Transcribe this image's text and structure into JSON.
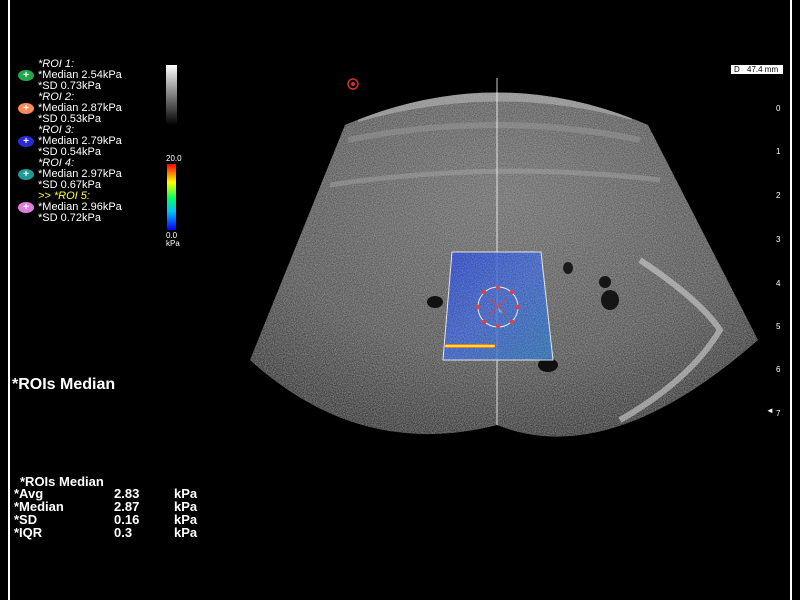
{
  "rois": [
    {
      "title": "*ROI 1:",
      "median": "*Median 2.54kPa",
      "sd": "*SD     0.73kPa",
      "icon": "plus-icon",
      "color": "#22a84a",
      "active": false
    },
    {
      "title": "*ROI 2:",
      "median": "*Median 2.87kPa",
      "sd": "*SD     0.53kPa",
      "icon": "plus-icon",
      "color": "#ff8a5c",
      "active": false
    },
    {
      "title": "*ROI 3:",
      "median": "*Median 2.79kPa",
      "sd": "*SD     0.54kPa",
      "icon": "plus-icon",
      "color": "#2a2ad8",
      "active": false
    },
    {
      "title": "*ROI 4:",
      "median": "*Median 2.97kPa",
      "sd": "*SD     0.67kPa",
      "icon": "plus-icon",
      "color": "#1f9a96",
      "active": false
    },
    {
      "title": ">> *ROI 5:",
      "median": "*Median 2.96kPa",
      "sd": "*SD     0.72kPa",
      "icon": "plus-icon",
      "color": "#e07ee0",
      "active": true
    }
  ],
  "color_scale": {
    "max": "20.0",
    "min": "0.0",
    "unit": "kPa"
  },
  "big_title": "*ROIs Median",
  "summary": {
    "title": "*ROIs Median",
    "rows": [
      {
        "label": "*Avg",
        "value": "2.83",
        "unit": "kPa"
      },
      {
        "label": "*Median",
        "value": "2.87",
        "unit": "kPa"
      },
      {
        "label": "*SD",
        "value": "0.16",
        "unit": "kPa"
      },
      {
        "label": "*IQR",
        "value": "0.3",
        "unit": "kPa"
      }
    ]
  },
  "depth": {
    "key": "D",
    "value": "47.4 mm"
  },
  "depth_ticks": [
    "0",
    "1",
    "2",
    "3",
    "4",
    "5",
    "6",
    "7"
  ],
  "depth_marker_icon": "triangle-left-icon",
  "depth_marker_glyph": "◄",
  "colors": {
    "background": "#000000",
    "text": "#ffffff",
    "active_roi": "#ffff33"
  }
}
